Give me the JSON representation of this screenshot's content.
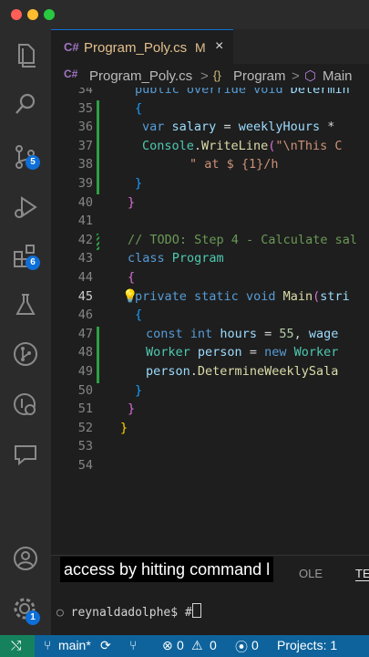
{
  "window": {
    "controls": [
      "close",
      "minimize",
      "maximize"
    ]
  },
  "activity_bar": {
    "items": [
      {
        "name": "explorer"
      },
      {
        "name": "search"
      },
      {
        "name": "source-control",
        "badge": "5"
      },
      {
        "name": "run-debug"
      },
      {
        "name": "extensions",
        "badge": "6"
      },
      {
        "name": "testing"
      },
      {
        "name": "git-graph"
      },
      {
        "name": "remote"
      },
      {
        "name": "comments"
      }
    ],
    "bottom": [
      {
        "name": "accounts"
      },
      {
        "name": "manage",
        "badge": "1"
      }
    ]
  },
  "tab": {
    "label": "Program_Poly.cs",
    "modified": "M",
    "close": "×"
  },
  "breadcrumbs": {
    "file": "Program_Poly.cs",
    "class": "Program",
    "method": "Main",
    "sep": ">"
  },
  "editor": {
    "lines": [
      {
        "n": "34",
        "code": "public override void Determin"
      },
      {
        "n": "35",
        "code": "{"
      },
      {
        "n": "36",
        "code": "var salary = weeklyHours *"
      },
      {
        "n": "37",
        "code": "Console.WriteLine(\"\\nThis C"
      },
      {
        "n": "38",
        "code": "\" at $ {1}/h"
      },
      {
        "n": "39",
        "code": "}"
      },
      {
        "n": "40",
        "code": "}"
      },
      {
        "n": "41",
        "code": ""
      },
      {
        "n": "42",
        "code": "// TODO: Step 4 - Calculate sal"
      },
      {
        "n": "43",
        "code": "class Program"
      },
      {
        "n": "44",
        "code": "{"
      },
      {
        "n": "45",
        "code": "private static void Main(stri"
      },
      {
        "n": "46",
        "code": "{"
      },
      {
        "n": "47",
        "code": "const int hours = 55, wage"
      },
      {
        "n": "48",
        "code": "Worker person = new Worker"
      },
      {
        "n": "49",
        "code": "person.DetermineWeeklySala"
      },
      {
        "n": "50",
        "code": "}"
      },
      {
        "n": "51",
        "code": "}"
      },
      {
        "n": "52",
        "code": "}"
      },
      {
        "n": "53",
        "code": ""
      },
      {
        "n": "54",
        "code": ""
      }
    ]
  },
  "panel": {
    "tab_console": "OLE",
    "tab_terminal": "TE",
    "prompt": "reynaldadolphe$ #"
  },
  "caption": "access by hitting command l",
  "status_bar": {
    "branch": "main*",
    "errors": "0",
    "warnings": "0",
    "ports": "0",
    "projects": "Projects: 1"
  }
}
